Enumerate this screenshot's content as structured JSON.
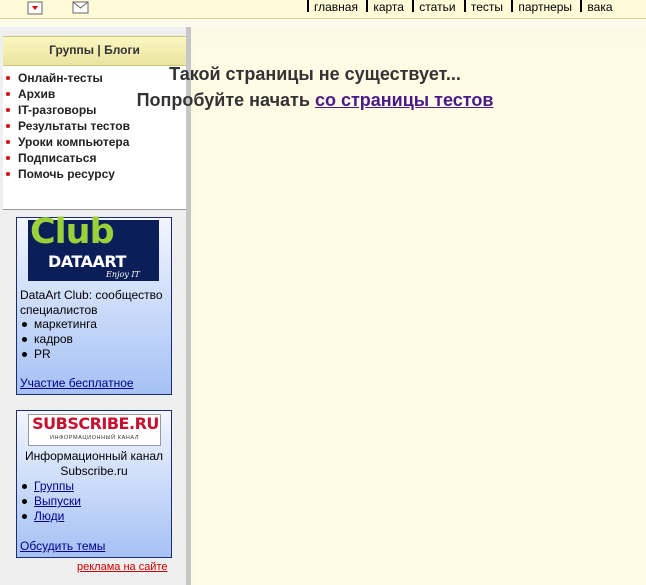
{
  "top_nav": {
    "items": [
      "главная",
      "карта",
      "статьи",
      "тесты",
      "партнеры",
      "вака"
    ]
  },
  "sidebar": {
    "header": "Группы | Блоги",
    "menu": [
      "Онлайн-тесты",
      "Архив",
      "IT-разговоры",
      "Результаты тестов",
      "Уроки компьютера",
      "Подписаться",
      "Помочь ресурсу"
    ]
  },
  "ad_dataart": {
    "logo_club": "Club",
    "logo_brand": "DATAART",
    "logo_tagline": "Enjoy IT",
    "text": "DataArt Club: сообщество специалистов",
    "items": [
      "маркетинга",
      "кадров",
      "PR"
    ],
    "link": "Участие бесплатное"
  },
  "ad_subscribe": {
    "logo": "SUBSCRIBE.RU",
    "logo_tagline": "ИНФОРМАЦИОННЫЙ КАНАЛ",
    "text": "Информационный канал Subscribe.ru",
    "items": [
      "Группы",
      "Выпуски",
      "Люди"
    ],
    "link": "Обсудить темы"
  },
  "ads_link": "реклама на сайте",
  "main": {
    "line1": "Такой страницы не существует...",
    "line2_prefix": "Попробуйте начать",
    "line2_link": "со страницы тестов"
  },
  "colors": {
    "accent_red": "#e00000",
    "main_bg": "#fffbe5",
    "link_purple": "#4a1a8a"
  }
}
